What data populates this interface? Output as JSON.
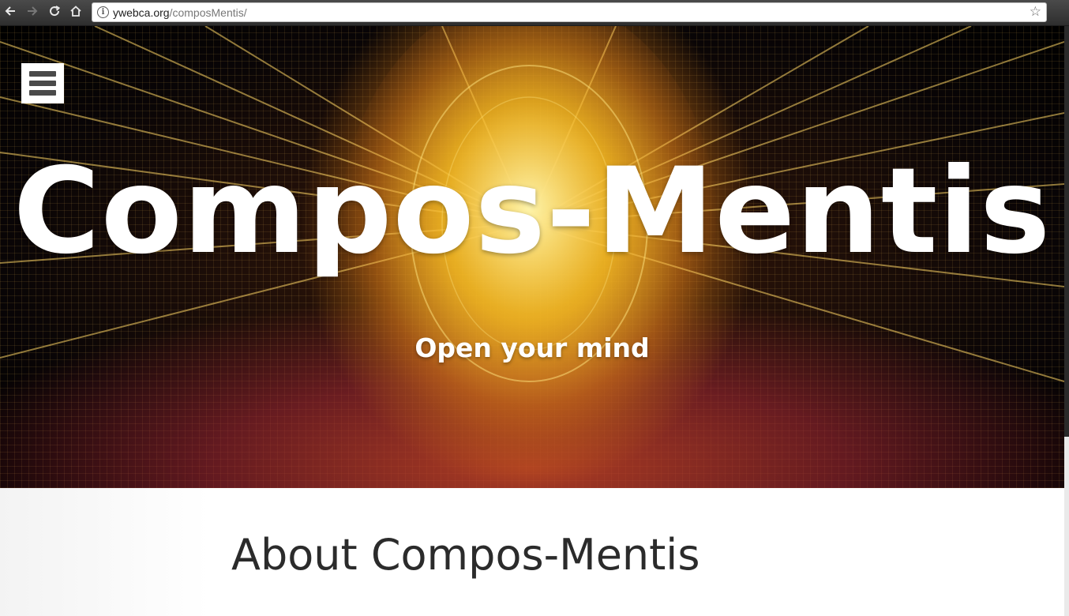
{
  "browser": {
    "url_domain": "ywebca.org",
    "url_path": "/composMentis/",
    "back_icon": "arrow-left-icon",
    "forward_icon": "arrow-right-icon",
    "reload_icon": "reload-icon",
    "home_icon": "home-icon",
    "info_icon_glyph": "i",
    "star_icon_glyph": "☆"
  },
  "hero": {
    "menu_icon": "hamburger-menu-icon",
    "title": "Compos-Mentis",
    "tagline": "Open your mind"
  },
  "main": {
    "heading": "About Compos-Mentis"
  },
  "colors": {
    "heading_text": "#2b2b2b",
    "hero_text": "#ffffff",
    "hero_glow": "#f5be28"
  }
}
